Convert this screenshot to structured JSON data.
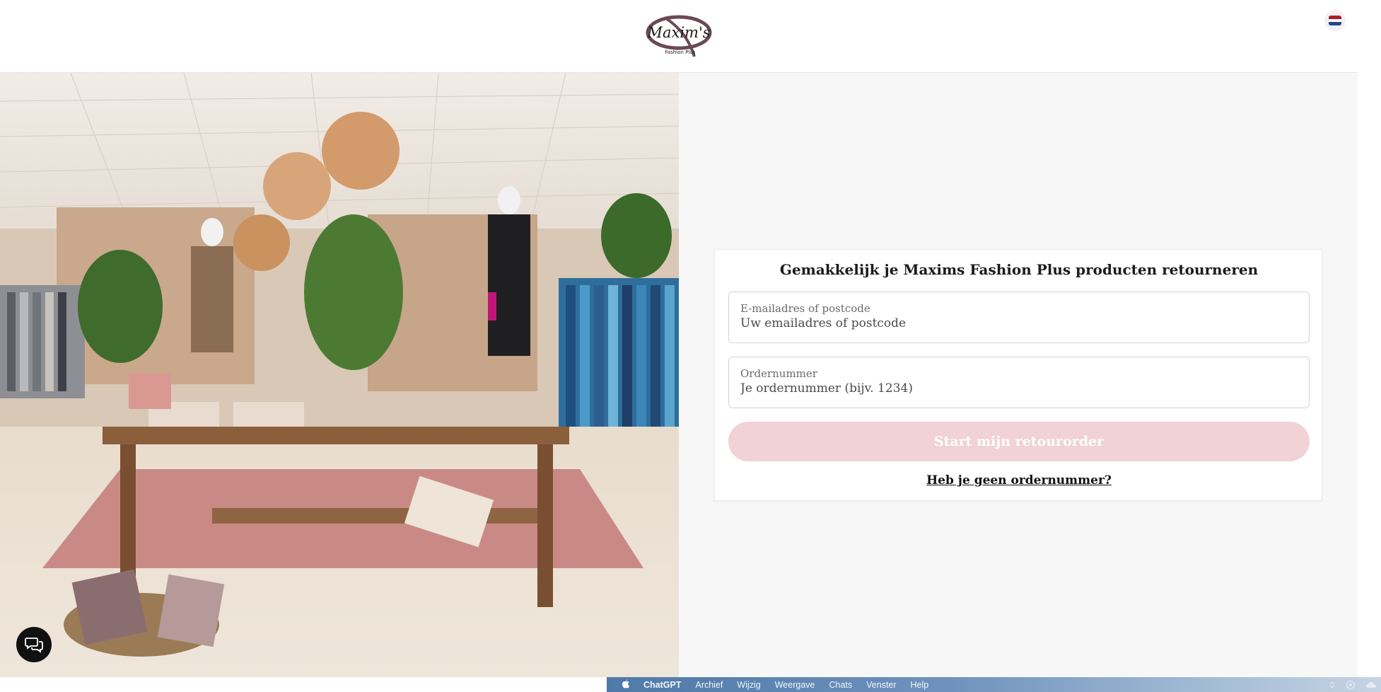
{
  "header": {
    "logo_text": "Maxim's",
    "logo_subtext": "Fashion Plus",
    "language_flag": "dutch-flag-icon",
    "flag_colors": [
      "#ae1c28",
      "#ffffff",
      "#21468b"
    ]
  },
  "form": {
    "title": "Gemakkelijk je Maxims Fashion Plus producten retourneren",
    "email_label": "E-mailadres of postcode",
    "email_placeholder": "Uw emailadres of postcode",
    "order_label": "Ordernummer",
    "order_placeholder": "Je ordernummer (bijv. 1234)",
    "submit_label": "Start mijn retourorder",
    "no_order_link": "Heb je geen ordernummer?"
  },
  "colors": {
    "accent_disabled": "#f1d2d6",
    "panel_bg": "#f7f7f7"
  },
  "chat": {
    "icon": "chat-bubble-icon"
  },
  "menubar": {
    "apple_icon": "apple-icon",
    "app_name": "ChatGPT",
    "items": [
      "Archief",
      "Wijzig",
      "Weergave",
      "Chats",
      "Venster",
      "Help"
    ]
  }
}
